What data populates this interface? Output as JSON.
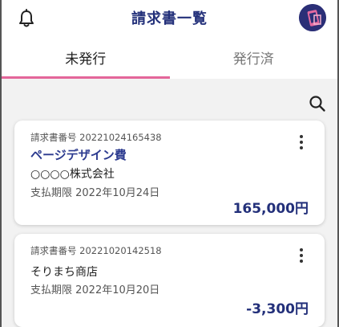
{
  "header": {
    "title": "請求書一覧"
  },
  "tabs": [
    {
      "label": "未発行",
      "active": true
    },
    {
      "label": "発行済",
      "active": false
    }
  ],
  "icons": {
    "bell": "bell-icon",
    "search": "search-icon",
    "avatar": "avatar",
    "menu": "kebab-menu-icon"
  },
  "colors": {
    "accent": "#e4669a",
    "brand": "#23307a",
    "avatar_bg": "#2b2f77"
  },
  "invoices": [
    {
      "number": "請求書番号 20221024165438",
      "title": "ページデザイン費",
      "client": "○○○○株式会社",
      "due": "支払期限 2022年10月24日",
      "amount": "165,000円"
    },
    {
      "number": "請求書番号 20221020142518",
      "title": "",
      "client": "そりまち商店",
      "due": "支払期限 2022年10月20日",
      "amount": "-3,300円"
    }
  ]
}
